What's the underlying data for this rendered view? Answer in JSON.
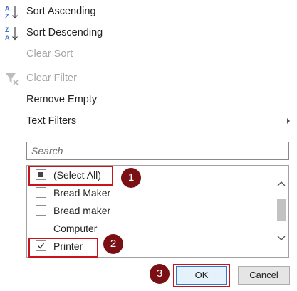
{
  "menu": {
    "sort_ascending": "Sort Ascending",
    "sort_descending": "Sort Descending",
    "clear_sort": "Clear Sort",
    "clear_filter": "Clear Filter",
    "remove_empty": "Remove Empty",
    "text_filters": "Text Filters"
  },
  "search": {
    "placeholder": "Search"
  },
  "list": {
    "items": [
      {
        "label": "(Select All)",
        "state": "partial"
      },
      {
        "label": "Bread Maker",
        "state": "unchecked"
      },
      {
        "label": "Bread maker",
        "state": "unchecked"
      },
      {
        "label": "Computer",
        "state": "unchecked"
      },
      {
        "label": "Printer",
        "state": "checked"
      }
    ]
  },
  "buttons": {
    "ok": "OK",
    "cancel": "Cancel"
  },
  "annotations": {
    "step1": "1",
    "step2": "2",
    "step3": "3"
  },
  "colors": {
    "highlight": "#c8151b",
    "badge": "#7a1013",
    "ok_border": "#2b7ad0"
  }
}
